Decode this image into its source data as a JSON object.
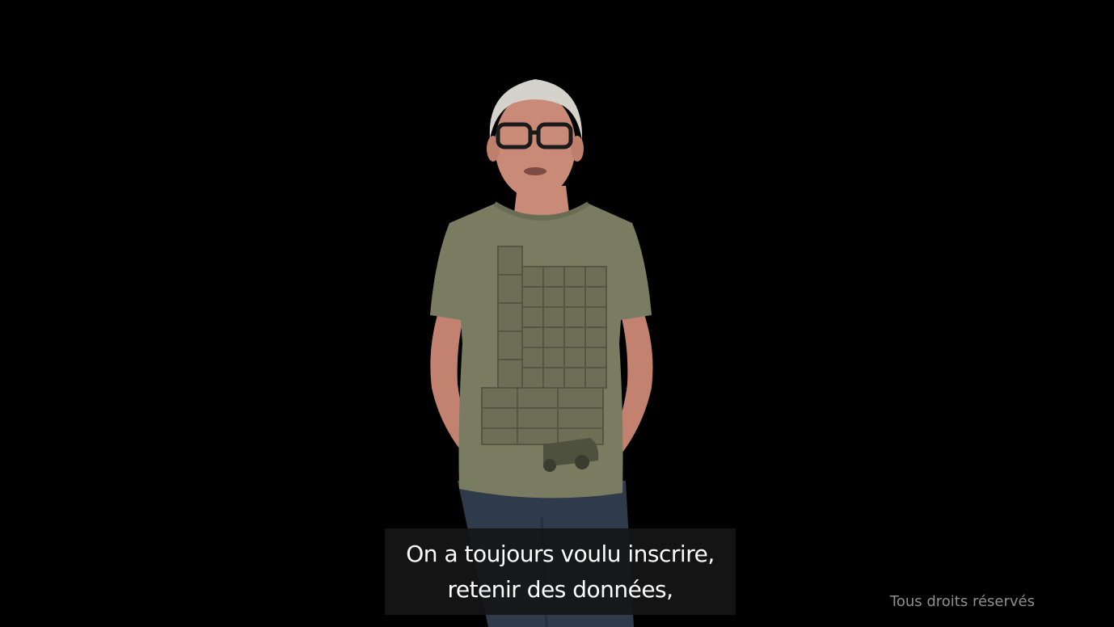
{
  "video": {
    "subtitle_lines": [
      "On a toujours voulu inscrire,",
      "retenir des données,"
    ],
    "rights_notice": "Tous droits réservés"
  },
  "colors": {
    "background": "#000000",
    "shirt": "#7a7c62",
    "jeans": "#2f3a4a",
    "skin": "#c98a78",
    "hair": "#d5d2cc",
    "subtitle_box": "#161616",
    "subtitle_text": "#ffffff",
    "rights_text": "#8f8f8f"
  }
}
